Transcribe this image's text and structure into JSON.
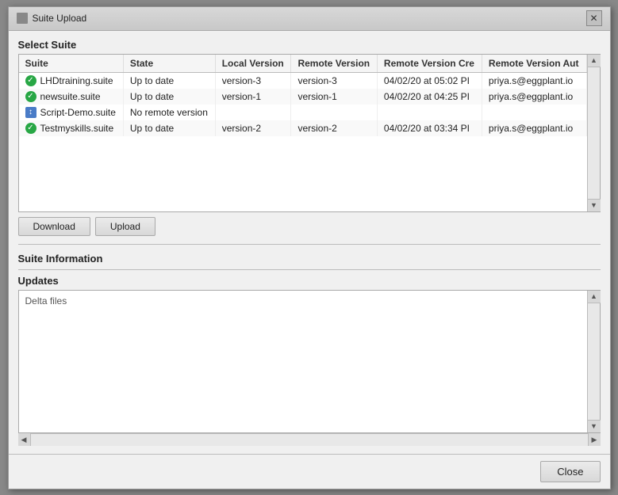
{
  "dialog": {
    "title": "Suite Upload",
    "close_icon": "✕"
  },
  "select_suite_label": "Select Suite",
  "table": {
    "columns": [
      "Suite",
      "State",
      "Local Version",
      "Remote Version",
      "Remote Version Cre",
      "Remote Version Aut"
    ],
    "rows": [
      {
        "suite": "LHDtraining.suite",
        "icon_type": "green",
        "state": "Up to date",
        "local_version": "version-3",
        "remote_version": "version-3",
        "remote_created": "04/02/20 at 05:02 PI",
        "remote_author": "priya.s@eggplant.io"
      },
      {
        "suite": "newsuite.suite",
        "icon_type": "green",
        "state": "Up to date",
        "local_version": "version-1",
        "remote_version": "version-1",
        "remote_created": "04/02/20 at 04:25 PI",
        "remote_author": "priya.s@eggplant.io"
      },
      {
        "suite": "Script-Demo.suite",
        "icon_type": "blue",
        "state": "No remote version",
        "local_version": "",
        "remote_version": "",
        "remote_created": "",
        "remote_author": ""
      },
      {
        "suite": "Testmyskills.suite",
        "icon_type": "green",
        "state": "Up to date",
        "local_version": "version-2",
        "remote_version": "version-2",
        "remote_created": "04/02/20 at 03:34 PI",
        "remote_author": "priya.s@eggplant.io"
      }
    ]
  },
  "buttons": {
    "download": "Download",
    "upload": "Upload"
  },
  "suite_information_label": "Suite Information",
  "updates": {
    "label": "Updates",
    "delta_files_label": "Delta files"
  },
  "bottom": {
    "close_label": "Close"
  }
}
